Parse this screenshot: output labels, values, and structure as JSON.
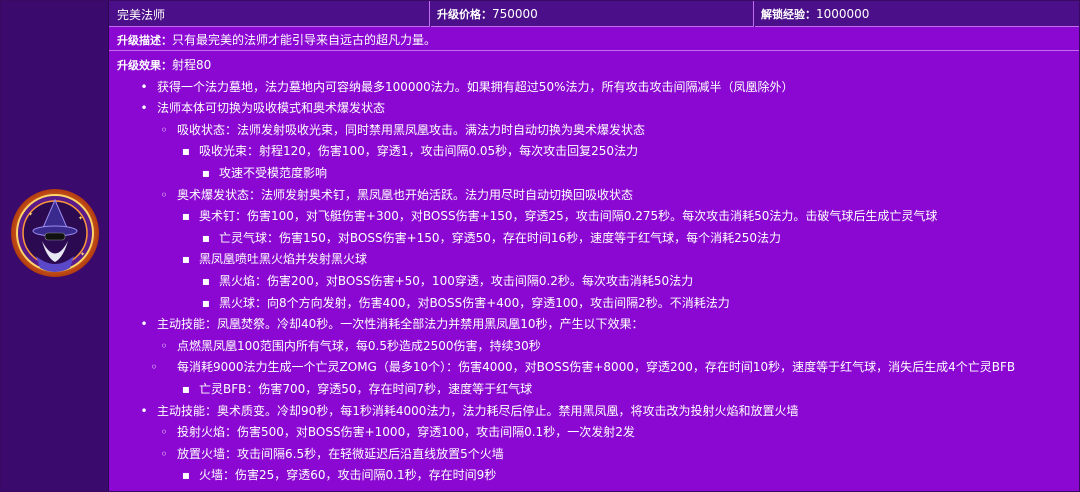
{
  "header": {
    "name": "完美法师",
    "price_label": "升级价格：",
    "price_value": "750000",
    "exp_label": "解锁经验：",
    "exp_value": "1000000"
  },
  "description": {
    "label": "升级描述：",
    "text": "只有最完美的法师才能引导来自远古的超凡力量。"
  },
  "effects": {
    "label": "升级效果：",
    "range": "射程80",
    "lines": [
      {
        "level": 1,
        "text": "获得一个法力墓地，法力墓地内可容纳最多100000法力。如果拥有超过50%法力，所有攻击攻击间隔减半（凤凰除外）"
      },
      {
        "level": 1,
        "text": "法师本体可切换为吸收模式和奥术爆发状态"
      },
      {
        "level": 2,
        "text": "吸收状态：法师发射吸收光束，同时禁用黑凤凰攻击。满法力时自动切换为奥术爆发状态"
      },
      {
        "level": 3,
        "text": "吸收光束：射程120，伤害100，穿透1，攻击间隔0.05秒，每次攻击回复250法力"
      },
      {
        "level": 4,
        "text": "攻速不受模范度影响"
      },
      {
        "level": 2,
        "text": "奥术爆发状态：法师发射奥术钉，黑凤凰也开始活跃。法力用尽时自动切换回吸收状态"
      },
      {
        "level": 3,
        "text": "奥术钉：伤害100，对飞艇伤害+300，对BOSS伤害+150，穿透25，攻击间隔0.275秒。每次攻击消耗50法力。击破气球后生成亡灵气球"
      },
      {
        "level": 4,
        "text": "亡灵气球：伤害150，对BOSS伤害+150，穿透50，存在时间16秒，速度等于红气球，每个消耗250法力"
      },
      {
        "level": 3,
        "text": "黑凤凰喷吐黑火焰并发射黑火球"
      },
      {
        "level": 4,
        "text": "黑火焰：伤害200，对BOSS伤害+50，100穿透，攻击间隔0.2秒。每次攻击消耗50法力"
      },
      {
        "level": 4,
        "text": "黑火球：向8个方向发射，伤害400，对BOSS伤害+400，穿透100，攻击间隔2秒。不消耗法力"
      },
      {
        "level": 1,
        "text": "主动技能：凤凰焚祭。冷却40秒。一次性消耗全部法力并禁用黑凤凰10秒，产生以下效果："
      },
      {
        "level": 2,
        "text": "点燃黑凤凰100范围内所有气球，每0.5秒造成2500伤害，持续30秒"
      },
      {
        "level": 2,
        "text": "每消耗9000法力生成一个亡灵ZOMG（最多10个）：伤害4000，对BOSS伤害+8000，穿透200，存在时间10秒，速度等于红气球，消失后生成4个亡灵BFB",
        "wrap": true
      },
      {
        "level": 3,
        "text": "亡灵BFB：伤害700，穿透50，存在时间7秒，速度等于红气球"
      },
      {
        "level": 1,
        "text": "主动技能：奥术质变。冷却90秒，每1秒消耗4000法力，法力耗尽后停止。禁用黑凤凰，将攻击改为投射火焰和放置火墙"
      },
      {
        "level": 2,
        "text": "投射火焰：伤害500，对BOSS伤害+1000，穿透100，攻击间隔0.1秒，一次发射2发"
      },
      {
        "level": 2,
        "text": "放置火墙：攻击间隔6.5秒，在轻微延迟后沿直线放置5个火墙"
      },
      {
        "level": 3,
        "text": "火墙：伤害25，穿透60，攻击间隔0.1秒，存在时间9秒"
      }
    ]
  },
  "bullets": {
    "1": "•",
    "2": "◦",
    "3": "▪",
    "4": "▪"
  },
  "colors": {
    "background": "#8b08d2",
    "header": "#4b0f8a",
    "left_column": "#3a0a6c"
  }
}
